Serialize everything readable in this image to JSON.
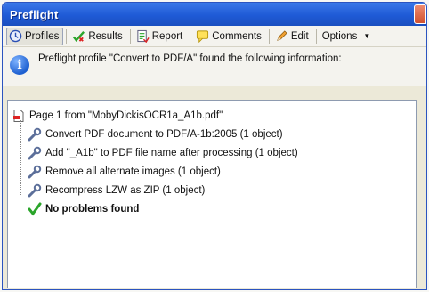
{
  "window": {
    "title": "Preflight"
  },
  "toolbar": {
    "profiles": "Profiles",
    "results": "Results",
    "report": "Report",
    "comments": "Comments",
    "edit": "Edit",
    "options": "Options"
  },
  "info": {
    "message": "Preflight profile \"Convert to PDF/A\" found the following information:"
  },
  "results": {
    "page": "Page 1 from \"MobyDickisOCR1a_A1b.pdf\"",
    "items": [
      "Convert PDF document to PDF/A-1b:2005 (1 object)",
      "Add \"_A1b\" to PDF file name after processing (1 object)",
      "Remove all alternate images (1 object)",
      "Recompress LZW as ZIP  (1 object)"
    ],
    "status": "No problems found"
  },
  "colors": {
    "titlebar": "#1f5ad6",
    "check": "#2aa52a",
    "info": "#1d5fd0"
  }
}
